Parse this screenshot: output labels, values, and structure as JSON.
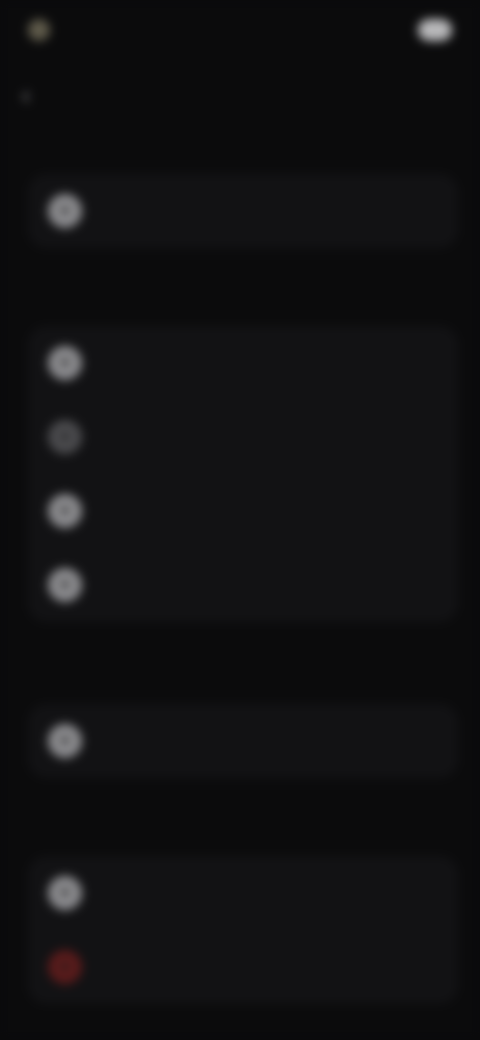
{
  "status_bar": {
    "time": "",
    "right_text": ""
  },
  "header": {
    "title": ""
  },
  "sections": [
    {
      "label": "",
      "items": [
        {
          "label": "",
          "icon": "user-icon"
        }
      ]
    },
    {
      "label": "",
      "items": [
        {
          "label": "",
          "icon": "bell-icon"
        },
        {
          "label": "",
          "icon": "lock-icon"
        },
        {
          "label": "",
          "icon": "palette-icon"
        },
        {
          "label": "",
          "icon": "globe-icon"
        }
      ]
    },
    {
      "label": "",
      "items": [
        {
          "label": "",
          "icon": "shield-icon"
        }
      ]
    },
    {
      "label": "",
      "items": [
        {
          "label": "",
          "icon": "info-icon"
        },
        {
          "label": "",
          "icon": "logout-icon",
          "color": "#5a1b1b"
        }
      ]
    }
  ],
  "colors": {
    "background": "#0b0b0c",
    "card": "#121214",
    "danger": "#5a1b1b"
  }
}
